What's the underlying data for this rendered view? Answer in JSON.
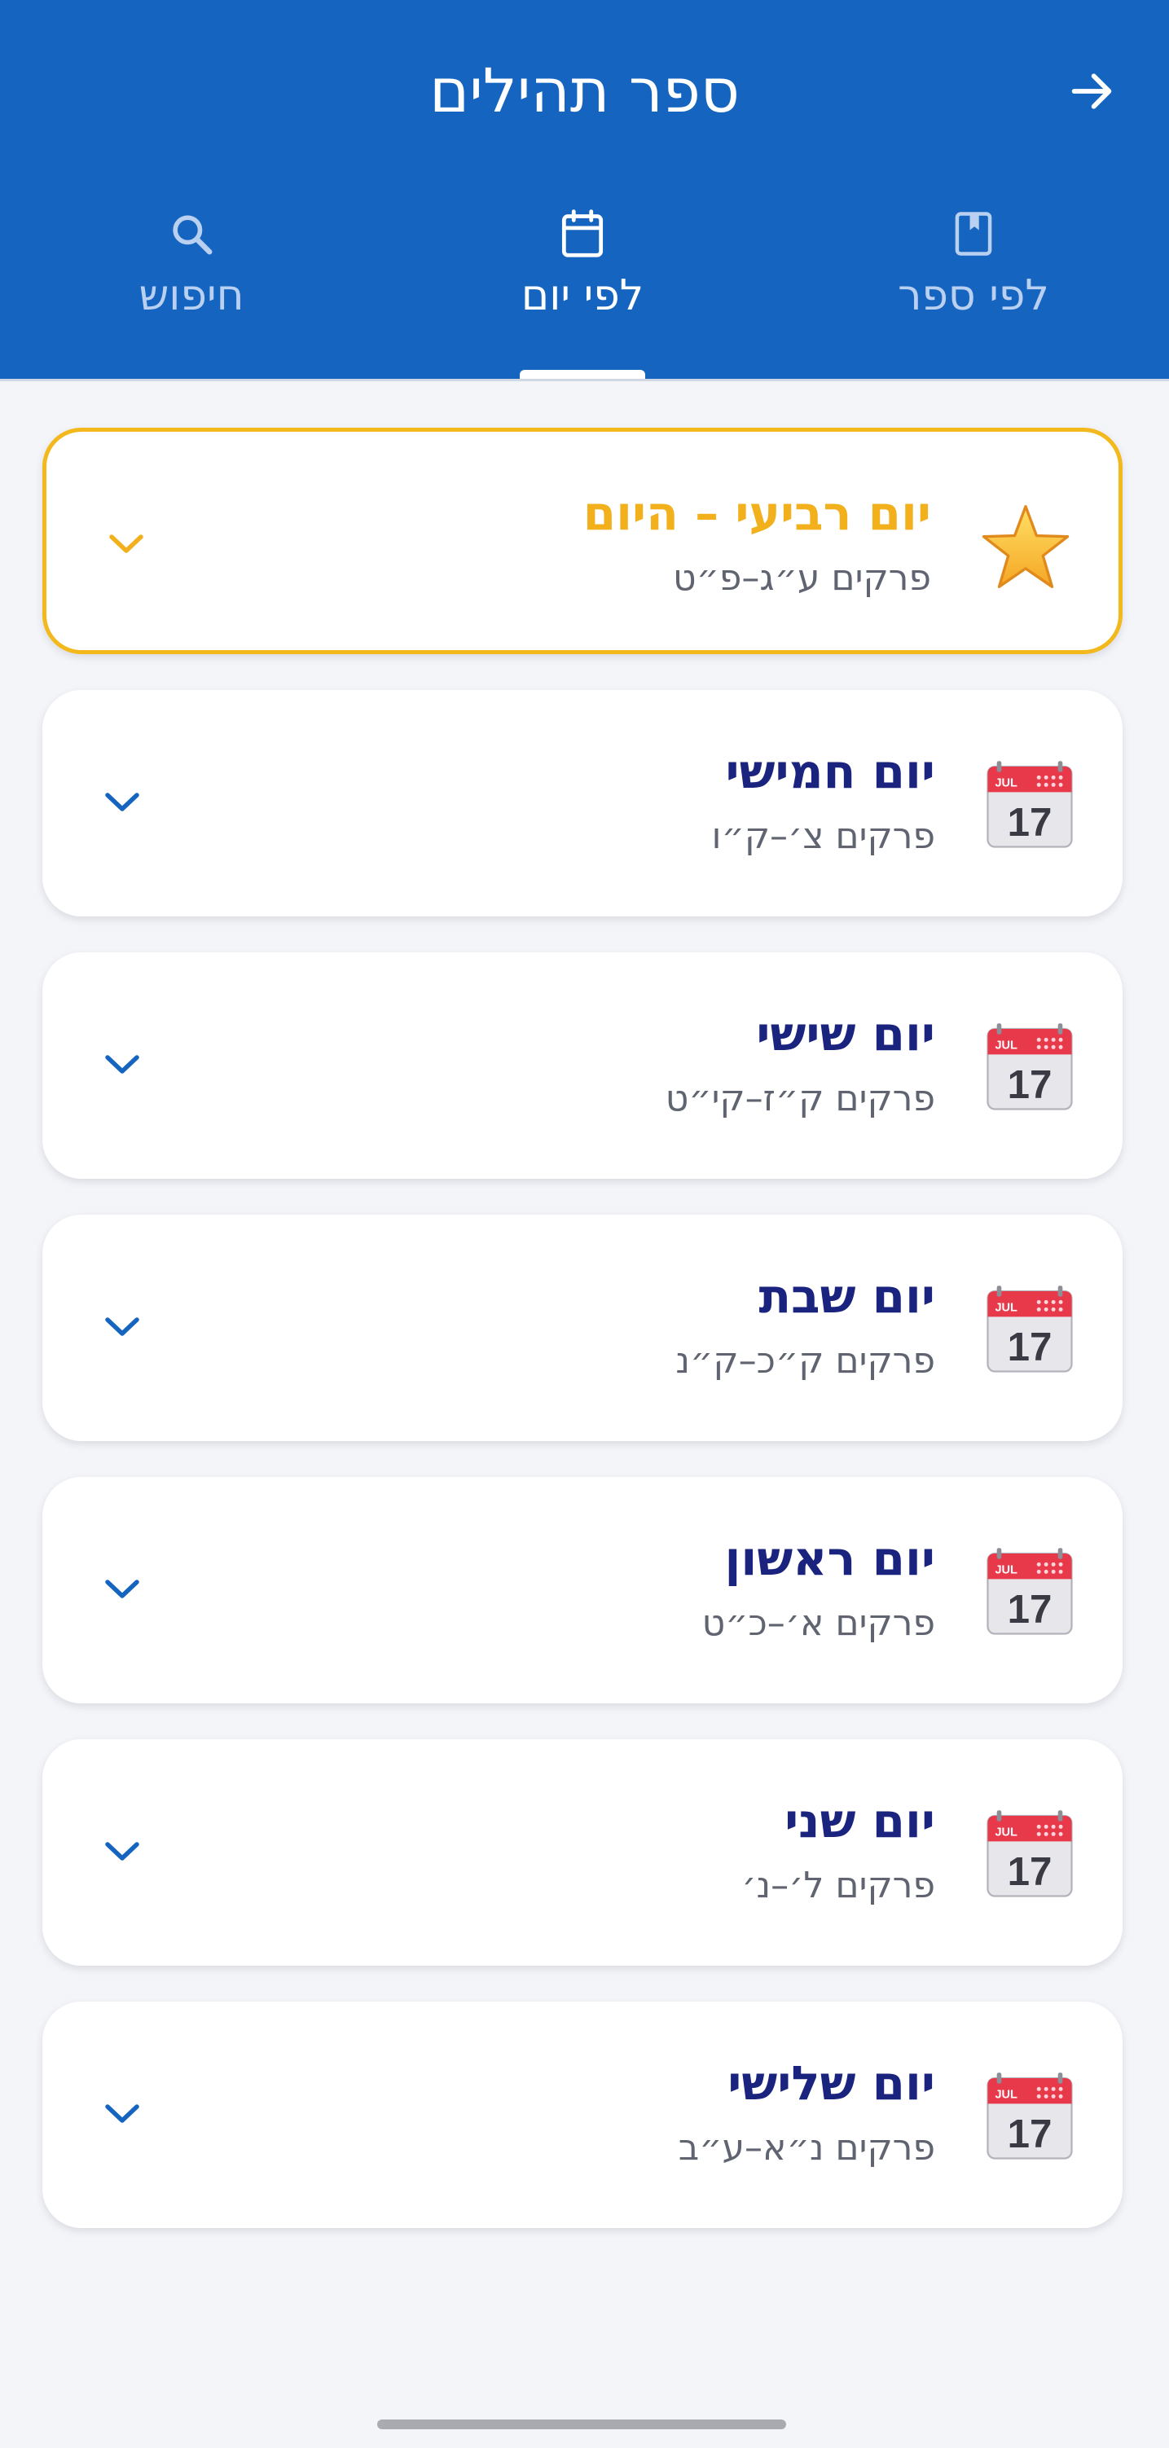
{
  "header": {
    "title": "ספר תהילים",
    "back_icon": "arrow-right-icon"
  },
  "tabs": [
    {
      "label": "לפי ספר",
      "icon": "book-icon",
      "active": false
    },
    {
      "label": "לפי יום",
      "icon": "calendar-icon",
      "active": true
    },
    {
      "label": "חיפוש",
      "icon": "search-icon",
      "active": false
    }
  ],
  "days": [
    {
      "title": "יום רביעי – היום",
      "subtitle": "פרקים ע״ג–פ״ט",
      "icon": "star-icon",
      "today": true
    },
    {
      "title": "יום חמישי",
      "subtitle": "פרקים צ׳–ק״ו",
      "icon": "calendar-17-icon",
      "today": false
    },
    {
      "title": "יום שישי",
      "subtitle": "פרקים ק״ז–קי״ט",
      "icon": "calendar-17-icon",
      "today": false
    },
    {
      "title": "יום שבת",
      "subtitle": "פרקים ק״כ–ק״נ",
      "icon": "calendar-17-icon",
      "today": false
    },
    {
      "title": "יום ראשון",
      "subtitle": "פרקים א׳–כ״ט",
      "icon": "calendar-17-icon",
      "today": false
    },
    {
      "title": "יום שני",
      "subtitle": "פרקים ל׳–נ׳",
      "icon": "calendar-17-icon",
      "today": false
    },
    {
      "title": "יום שלישי",
      "subtitle": "פרקים נ״א–ע״ב",
      "icon": "calendar-17-icon",
      "today": false
    }
  ],
  "calendar_icon": {
    "month": "JUL",
    "day": "17"
  },
  "colors": {
    "appbar": "#1565c0",
    "today_accent": "#f2b81c",
    "title_text": "#1a237e",
    "subtitle_text": "#5f6470",
    "chevron": "#1565c0",
    "background": "#f4f5f9"
  }
}
